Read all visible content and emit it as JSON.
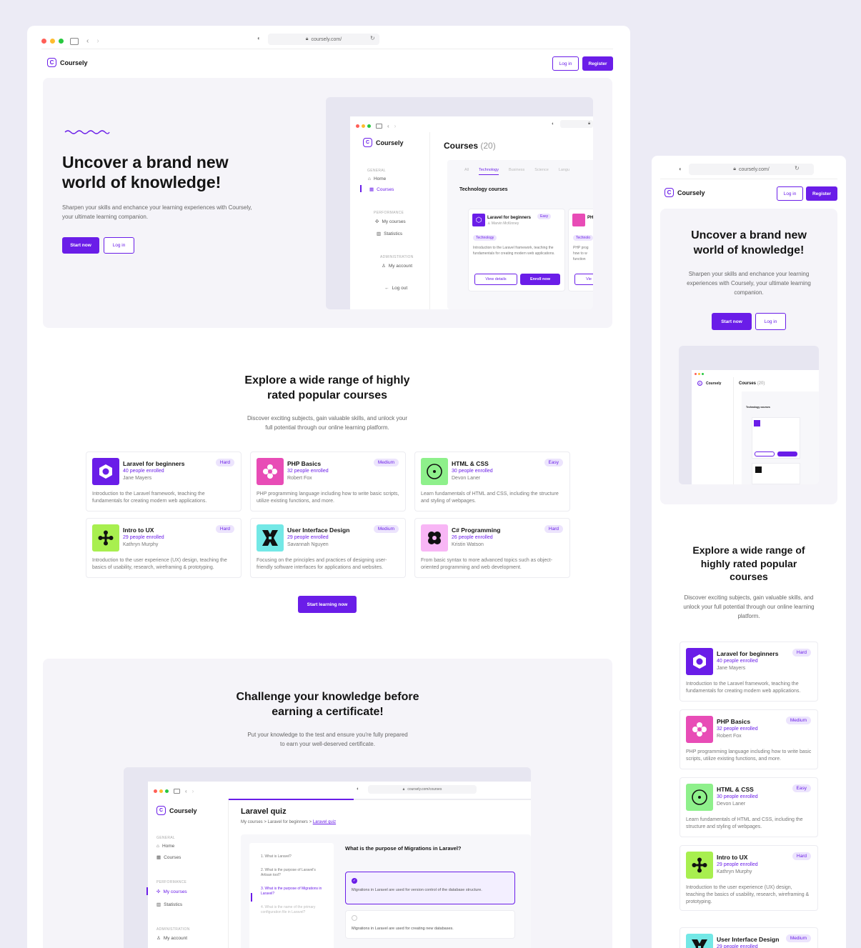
{
  "brand": {
    "name": "Coursely",
    "logo_letter": "C",
    "accent": "#6a1de8"
  },
  "browser": {
    "url": "coursely.com/",
    "url_quiz": "coursely.com/courses"
  },
  "nav": {
    "login": "Log in",
    "register": "Register"
  },
  "hero": {
    "title_line1": "Uncover a brand new",
    "title_line2": "world of knowledge!",
    "subtitle": "Sharpen your skills and enchance your learning experiences with Coursely, your ultimate learning companion.",
    "subtitle_mobile": "Sharpen your skills and enchance your learning experiences with Coursely, your ultimate learning companion.",
    "start": "Start now",
    "login": "Log in"
  },
  "app_mock": {
    "sidebar": {
      "general": "GENERAL",
      "home": "Home",
      "courses": "Courses",
      "performance": "PERFORMANCE",
      "my_courses": "My courses",
      "statistics": "Statistics",
      "administration": "ADMINISTRATION",
      "my_account": "My account",
      "log_out": "Log out"
    },
    "heading": "Courses",
    "count": "(20)",
    "tabs": [
      "All",
      "Technology",
      "Business",
      "Science",
      "Langu"
    ],
    "section": "Technology courses",
    "card": {
      "title": "Laravel for beginners",
      "badge": "Easy",
      "author": "Marvin McKinney",
      "tag": "Technology",
      "desc": "Introduction to the Laravel framework, teaching the fundamentals for creating modern web applications.",
      "view": "View details",
      "enroll": "Enroll now"
    },
    "card2": {
      "title": "PH",
      "tag": "Technolo",
      "desc_l1": "PHP prog",
      "desc_l2": "how to w",
      "desc_l3": "function",
      "view": "Vie"
    }
  },
  "explore": {
    "title_line1": "Explore a wide range of highly",
    "title_line2": "rated popular courses",
    "subtitle_line1": "Discover exciting subjects, gain valuable skills, and unlock your",
    "subtitle_line2": "full potential through our online learning platform.",
    "m_title_line1": "Explore a wide range of",
    "m_title_line2": "highly rated popular",
    "m_title_line3": "courses",
    "m_subtitle": "Discover exciting subjects, gain valuable skills, and unlock your full potential through our online learning platform.",
    "cta": "Start learning now"
  },
  "courses": [
    {
      "title": "Laravel for beginners",
      "enrolled": "40 people enrolled",
      "author": "Jane Mayers",
      "badge": "Hard",
      "desc": "Introduction to the Laravel framework, teaching the fundamentals for creating modern web applications.",
      "color": "#6a1de8"
    },
    {
      "title": "PHP Basics",
      "enrolled": "32 people enrolled",
      "author": "Robert Fox",
      "badge": "Medium",
      "desc": "PHP programming language including how to write basic scripts, utilize existing functions, and more.",
      "color": "#e84cb6"
    },
    {
      "title": "HTML & CSS",
      "enrolled": "30 people enrolled",
      "author": "Devon Laner",
      "badge": "Easy",
      "desc": "Learn fundamentals of HTML and CSS, including the structure and styling of webpages.",
      "color": "#8ef08b"
    },
    {
      "title": "Intro to UX",
      "enrolled": "29 people enrolled",
      "author": "Kathryn Murphy",
      "badge": "Hard",
      "desc": "Introduction to the user experience (UX) design, teaching the basics of usability, research, wireframing & prototyping.",
      "color": "#a8ef4f"
    },
    {
      "title": "User Interface Design",
      "enrolled": "29 people enrolled",
      "author": "Savannah Nguyen",
      "badge": "Medium",
      "desc": "Focusing on the principles and practices of designing user-friendly software interfaces for applications and websites.",
      "color": "#73e8e6"
    },
    {
      "title": "C# Programming",
      "enrolled": "26 people enrolled",
      "author": "Kristin Watson",
      "badge": "Hard",
      "desc": "From basic syntax to more advanced topics such as object-oriented programming and web development.",
      "color": "#f8b6f5"
    }
  ],
  "challenge": {
    "title_line1": "Challenge your knowledge before",
    "title_line2": "earning a certificate!",
    "subtitle_line1": "Put your knowledge to the test and ensure you're fully prepared",
    "subtitle_line2": "to earn your well-deserved certificate."
  },
  "quiz_mock": {
    "title": "Laravel quiz",
    "crumb1": "My courses",
    "crumb2": "Laravel for beginners",
    "crumb3": "Laravel quiz",
    "q1": "1. What is Laravel?",
    "q2": "2. What is the purpose of Laravel's Artisan tool?",
    "q3": "3. What is the purpose of Migrations in Laravel?",
    "q4": "4. What is the name of the primary configuration file in Laravel?",
    "question": "What is the purpose of Migrations in Laravel?",
    "answer1": "Migrations in Laravel are used for version control of the database structure.",
    "answer2": "Migrations in Laravel are used for creating new databases."
  }
}
